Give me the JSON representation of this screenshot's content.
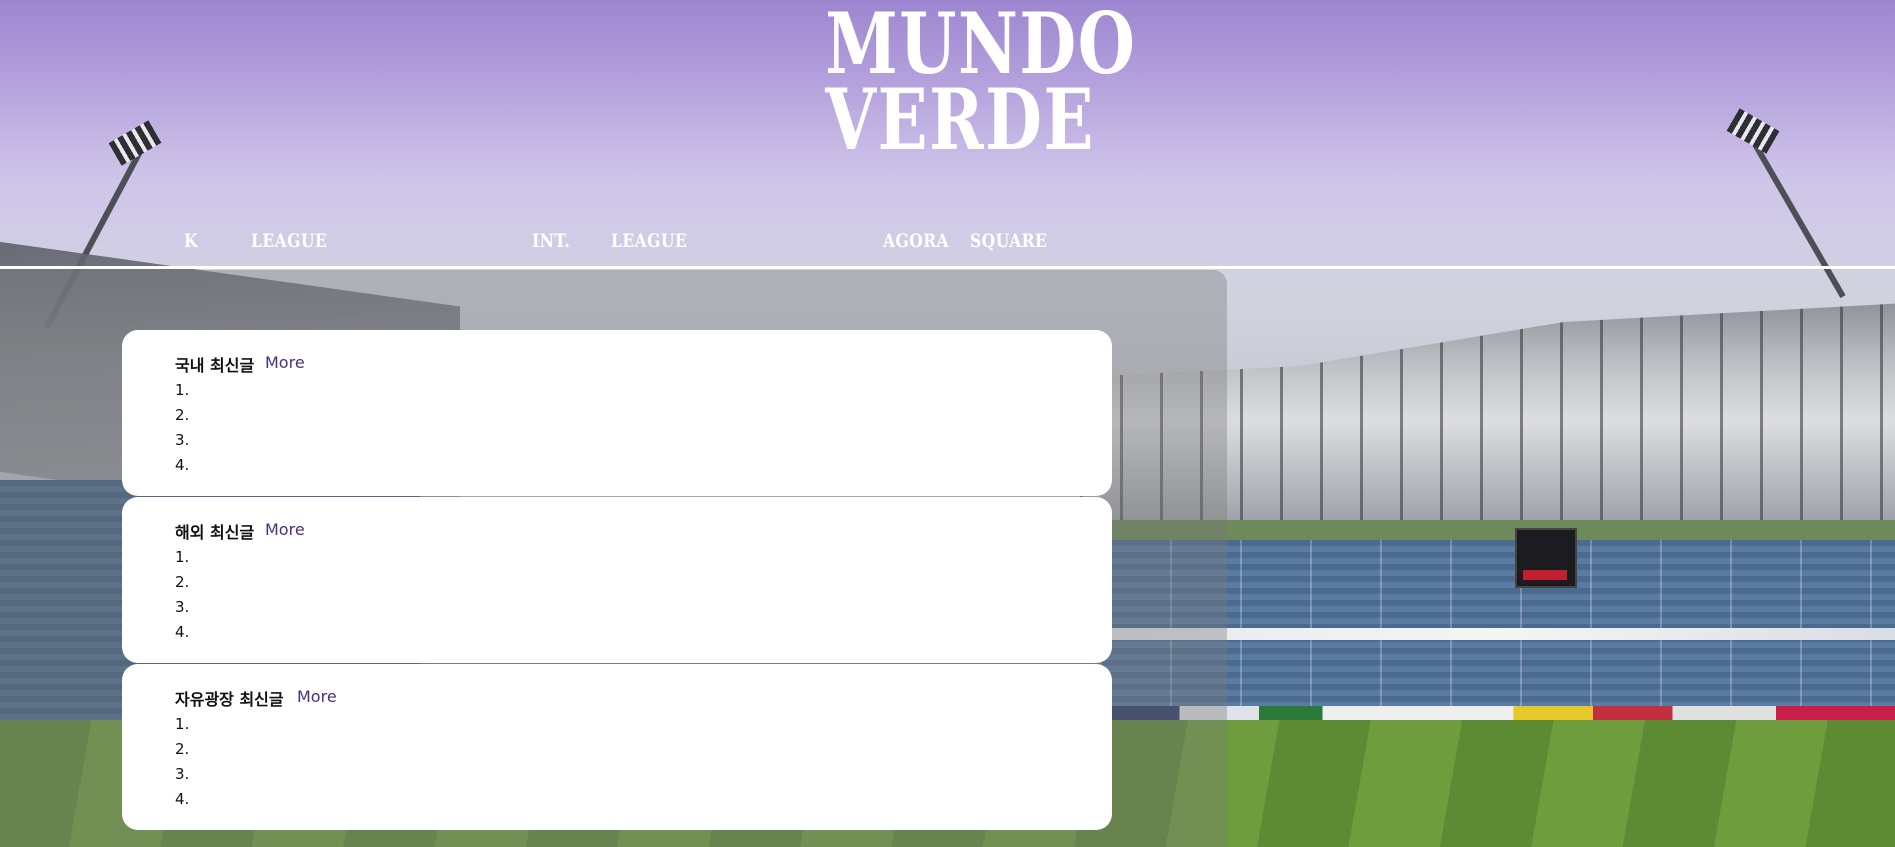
{
  "logo": {
    "line1": "MUNDO",
    "line2": "VERDE"
  },
  "nav": {
    "items": [
      {
        "label": "K"
      },
      {
        "label": "LEAGUE"
      },
      {
        "label": "INT."
      },
      {
        "label": "LEAGUE"
      },
      {
        "label": "AGORA"
      },
      {
        "label": "SQUARE"
      }
    ]
  },
  "sections": [
    {
      "title": "국내 최신글",
      "more": "More",
      "items": [
        "1.",
        "2.",
        "3.",
        "4."
      ]
    },
    {
      "title": "해외 최신글",
      "more": "More",
      "items": [
        "1.",
        "2.",
        "3.",
        "4."
      ]
    },
    {
      "title": "자유광장 최신글",
      "more": "More",
      "items": [
        "1.",
        "2.",
        "3.",
        "4."
      ]
    }
  ],
  "colors": {
    "more_link": "#4a2f7a",
    "nav_text": "#ffffff",
    "card_bg": "#ffffff"
  }
}
